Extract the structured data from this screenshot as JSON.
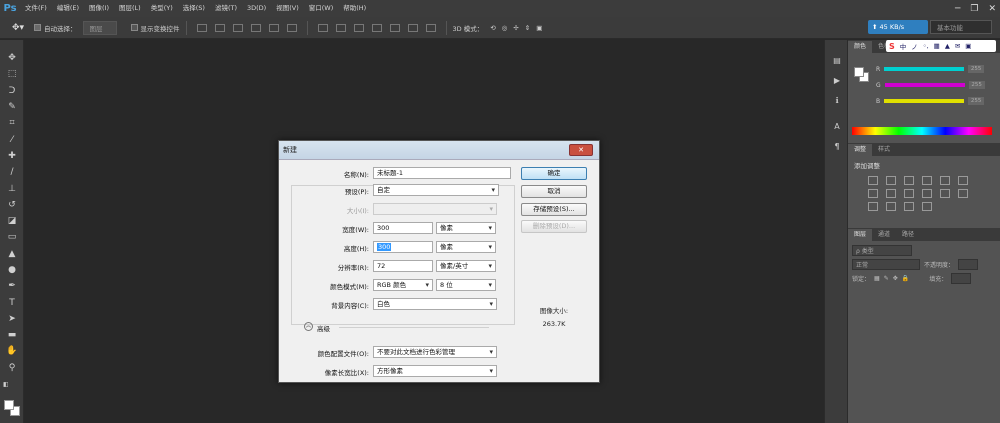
{
  "app": {
    "logo": "Ps"
  },
  "menu": [
    "文件(F)",
    "编辑(E)",
    "图像(I)",
    "图层(L)",
    "类型(Y)",
    "选择(S)",
    "滤镜(T)",
    "3D(D)",
    "视图(V)",
    "窗口(W)",
    "帮助(H)"
  ],
  "window_controls": {
    "minimize": "─",
    "restore": "❐",
    "close": "✕"
  },
  "options": {
    "auto_select_label": "自动选择：",
    "auto_select_value": "图层",
    "show_transform_label": "显示变换控件",
    "mode_3d_label": "3D 模式：",
    "speed": "45 KB/s",
    "workspace": "基本功能"
  },
  "ime": {
    "logo": "S",
    "items": [
      "中",
      "ノ",
      "◦,",
      "▦",
      "▲",
      "✉",
      "▣"
    ]
  },
  "panels": {
    "color_tabs": [
      "颜色",
      "色板"
    ],
    "rgb": [
      {
        "label": "R",
        "value": "255",
        "color": "#00d0d0"
      },
      {
        "label": "G",
        "value": "255",
        "color": "#d000d0"
      },
      {
        "label": "B",
        "value": "255",
        "color": "#e0e000"
      }
    ],
    "adjust_tabs": [
      "调整",
      "样式"
    ],
    "adjust_title": "添加调整",
    "layer_tabs": [
      "图层",
      "通道",
      "路径"
    ],
    "layer_kind": "ρ 类型",
    "blend_mode": "正常",
    "opacity_label": "不透明度：",
    "lock_label": "锁定：",
    "fill_label": "填充："
  },
  "dialog": {
    "title": "新建",
    "close": "✕",
    "name_label": "名称(N):",
    "name_value": "未标题-1",
    "preset_label": "预设(P):",
    "preset_value": "自定",
    "size_label": "大小(I):",
    "width_label": "宽度(W):",
    "width_value": "300",
    "width_unit": "像素",
    "height_label": "高度(H):",
    "height_value": "300",
    "height_unit": "像素",
    "resolution_label": "分辨率(R):",
    "resolution_value": "72",
    "resolution_unit": "像素/英寸",
    "color_mode_label": "颜色模式(M):",
    "color_mode_value": "RGB 颜色",
    "bit_depth_value": "8 位",
    "background_label": "背景内容(C):",
    "background_value": "白色",
    "advanced_label": "高级",
    "profile_label": "颜色配置文件(O):",
    "profile_value": "不要对此文档进行色彩管理",
    "aspect_label": "像素长宽比(X):",
    "aspect_value": "方形像素",
    "ok_button": "确定",
    "cancel_button": "取消",
    "save_preset_button": "存储预设(S)...",
    "delete_preset_button": "删除预设(D)...",
    "image_size_label": "图像大小:",
    "image_size_value": "263.7K"
  }
}
